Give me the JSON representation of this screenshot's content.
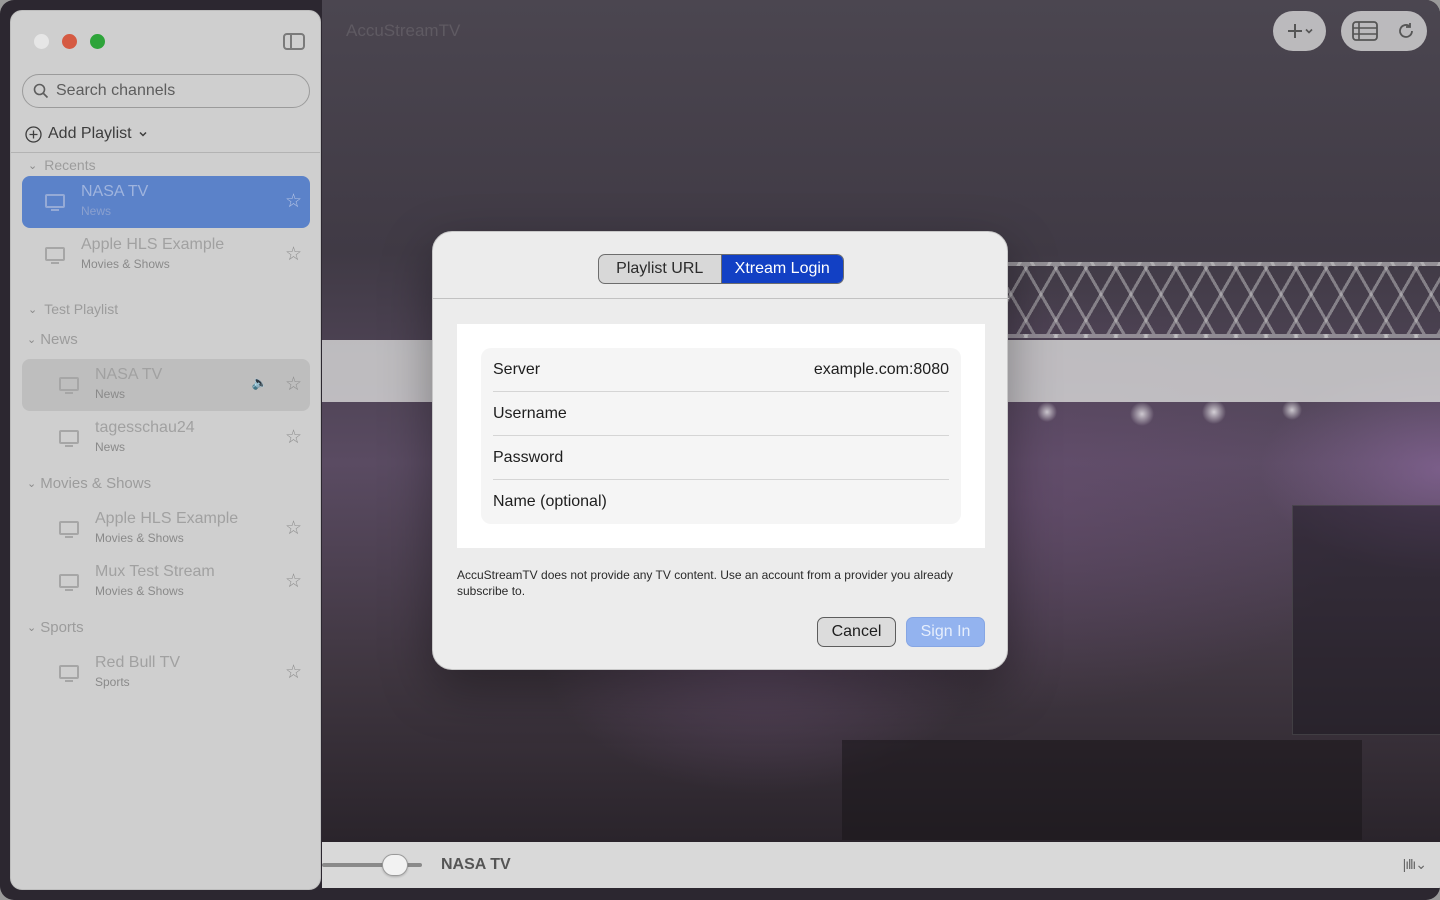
{
  "app": {
    "title": "AccuStreamTV"
  },
  "toolbar": {
    "add_icon": "plus-icon",
    "add_menu_icon": "chevron-down-icon",
    "list_icon": "list-icon",
    "refresh_icon": "refresh-icon"
  },
  "sidebar": {
    "search_placeholder": "Search channels",
    "add_playlist_label": "Add Playlist",
    "recents": {
      "title": "Recents",
      "items": [
        {
          "name": "NASA TV",
          "category": "News",
          "selected": true
        },
        {
          "name": "Apple HLS Example",
          "category": "Movies & Shows"
        }
      ]
    },
    "playlist": {
      "title": "Test Playlist",
      "groups": [
        {
          "title": "News",
          "items": [
            {
              "name": "NASA TV",
              "category": "News",
              "playing": true
            },
            {
              "name": "tagesschau24",
              "category": "News"
            }
          ]
        },
        {
          "title": "Movies & Shows",
          "items": [
            {
              "name": "Apple HLS Example",
              "category": "Movies & Shows"
            },
            {
              "name": "Mux Test Stream",
              "category": "Movies & Shows"
            }
          ]
        },
        {
          "title": "Sports",
          "items": [
            {
              "name": "Red Bull TV",
              "category": "Sports"
            }
          ]
        }
      ]
    }
  },
  "player": {
    "now_playing": "NASA TV"
  },
  "dialog": {
    "tabs": [
      "Playlist URL",
      "Xtream Login"
    ],
    "active_tab": "Xtream Login",
    "fields": [
      {
        "label": "Server",
        "value": "example.com:8080"
      },
      {
        "label": "Username",
        "value": ""
      },
      {
        "label": "Password",
        "value": ""
      },
      {
        "label": "Name (optional)",
        "value": ""
      }
    ],
    "disclaimer": "AccuStreamTV does not provide any TV content. Use an account from a provider you already subscribe to.",
    "cancel_label": "Cancel",
    "signin_label": "Sign In"
  },
  "colors": {
    "accent": "#1240c4",
    "selection": "#5b82c9",
    "signin_disabled": "#93b3ef"
  }
}
